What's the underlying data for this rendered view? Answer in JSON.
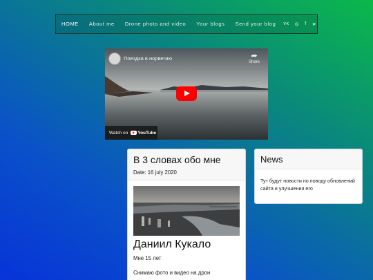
{
  "nav": {
    "items": [
      "HOME",
      "About me",
      "Drone photo and video",
      "Your blogs",
      "Send your blog"
    ],
    "social": [
      {
        "icon": "vk-icon",
        "glyph": "ᴠᴋ"
      },
      {
        "icon": "instagram-icon",
        "glyph": "◎"
      },
      {
        "icon": "facebook-icon",
        "glyph": "f"
      },
      {
        "icon": "telegram-icon",
        "glyph": "➤"
      }
    ]
  },
  "video": {
    "title": "Поездка в норвегию",
    "share_label": "Share",
    "watch_on": "Watch on",
    "youtube": "YouTube"
  },
  "about_card": {
    "title": "В 3 словах обо мне",
    "date": "Date: 16 july 2020",
    "name": "Даниил Кукало",
    "age": "Мне 15 лет",
    "description": "Снимаю фото и видео на дрон"
  },
  "news_card": {
    "title": "News",
    "text": "Тут будут новости по поводу обновлений сайта и улучшения его"
  },
  "colors": {
    "gradient_top": "#0bb84a",
    "gradient_bottom": "#0733d8",
    "youtube_red": "#ff0000"
  }
}
